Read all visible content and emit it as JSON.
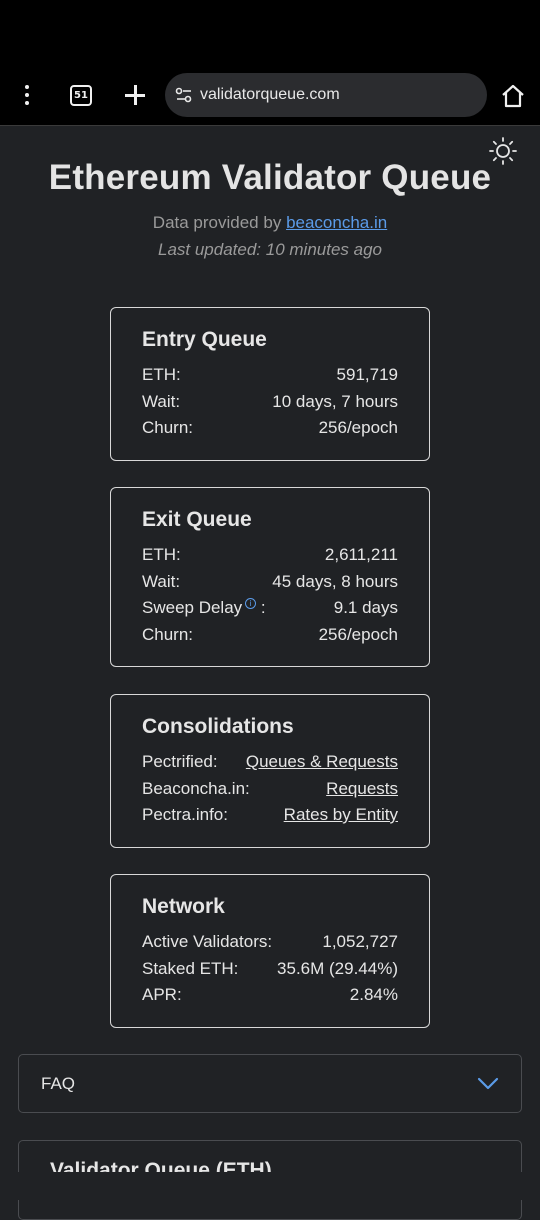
{
  "browser": {
    "tab_count": "51",
    "url": "validatorqueue.com"
  },
  "header": {
    "title": "Ethereum Validator Queue",
    "credit_prefix": "Data provided by",
    "credit_link": "beaconcha.in",
    "last_updated": "Last updated: 10 minutes ago"
  },
  "entry_queue": {
    "title": "Entry Queue",
    "rows": [
      {
        "label": "ETH:",
        "value": "591,719"
      },
      {
        "label": "Wait:",
        "value": "10 days, 7 hours"
      },
      {
        "label": "Churn:",
        "value": "256/epoch"
      }
    ]
  },
  "exit_queue": {
    "title": "Exit Queue",
    "rows": [
      {
        "label": "ETH:",
        "value": "2,611,211"
      },
      {
        "label": "Wait:",
        "value": "45 days, 8 hours"
      },
      {
        "label": "Sweep Delay",
        "suffix": ":",
        "value": "9.1 days"
      },
      {
        "label": "Churn:",
        "value": "256/epoch"
      }
    ]
  },
  "consolidations": {
    "title": "Consolidations",
    "rows": [
      {
        "label": "Pectrified:",
        "link": "Queues & Requests"
      },
      {
        "label": "Beaconcha.in:",
        "link": "Requests"
      },
      {
        "label": "Pectra.info:",
        "link": "Rates by Entity"
      }
    ]
  },
  "network": {
    "title": "Network",
    "rows": [
      {
        "label": "Active Validators:",
        "value": "1,052,727"
      },
      {
        "label": "Staked ETH:",
        "value": "35.6M (29.44%)"
      },
      {
        "label": "APR:",
        "value": "2.84%"
      }
    ]
  },
  "faq": {
    "label": "FAQ"
  },
  "chart_section": {
    "title": "Validator Queue (ETH)"
  },
  "colors": {
    "background": "#202225",
    "link": "#5b9be8",
    "card_border": "#d8d8d8"
  }
}
